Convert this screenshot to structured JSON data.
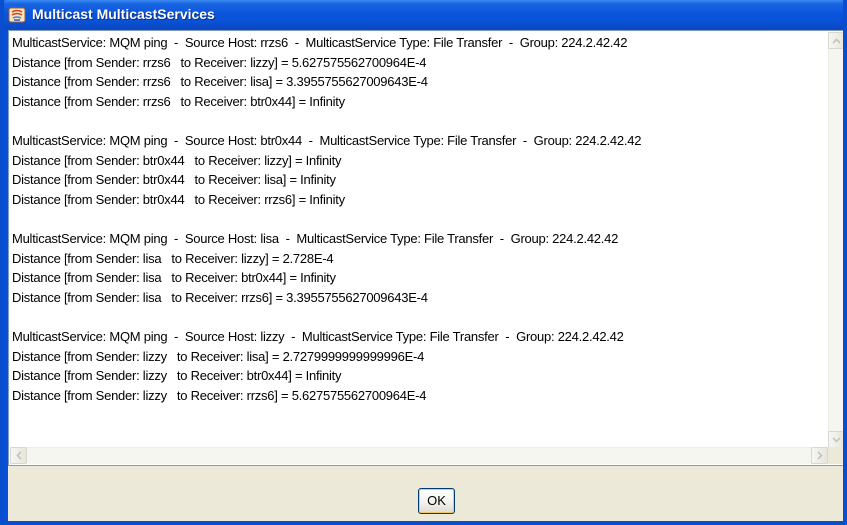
{
  "window": {
    "title": "Multicast MulticastServices",
    "close_label": "✕"
  },
  "output_lines": [
    "MulticastService: MQM ping  -  Source Host: rrzs6  -  MulticastService Type: File Transfer  -  Group: 224.2.42.42",
    "Distance [from Sender: rrzs6   to Receiver: lizzy] = 5.627575562700964E-4",
    "Distance [from Sender: rrzs6   to Receiver: lisa] = 3.3955755627009643E-4",
    "Distance [from Sender: rrzs6   to Receiver: btr0x44] = Infinity",
    "",
    "MulticastService: MQM ping  -  Source Host: btr0x44  -  MulticastService Type: File Transfer  -  Group: 224.2.42.42",
    "Distance [from Sender: btr0x44   to Receiver: lizzy] = Infinity",
    "Distance [from Sender: btr0x44   to Receiver: lisa] = Infinity",
    "Distance [from Sender: btr0x44   to Receiver: rrzs6] = Infinity",
    "",
    "MulticastService: MQM ping  -  Source Host: lisa  -  MulticastService Type: File Transfer  -  Group: 224.2.42.42",
    "Distance [from Sender: lisa   to Receiver: lizzy] = 2.728E-4",
    "Distance [from Sender: lisa   to Receiver: btr0x44] = Infinity",
    "Distance [from Sender: lisa   to Receiver: rrzs6] = 3.3955755627009643E-4",
    "",
    "MulticastService: MQM ping  -  Source Host: lizzy  -  MulticastService Type: File Transfer  -  Group: 224.2.42.42",
    "Distance [from Sender: lizzy   to Receiver: lisa] = 2.7279999999999996E-4",
    "Distance [from Sender: lizzy   to Receiver: btr0x44] = Infinity",
    "Distance [from Sender: lizzy   to Receiver: rrzs6] = 5.627575562700964E-4"
  ],
  "buttons": {
    "ok_label": "OK"
  },
  "icons": {
    "app": "java-app-icon",
    "scroll_up": "chevron-up-icon",
    "scroll_down": "chevron-down-icon",
    "scroll_left": "chevron-left-icon",
    "scroll_right": "chevron-right-icon"
  },
  "colors": {
    "titlebar": "#0a55dc",
    "close_button": "#e05a2e",
    "dialog_background": "#ece9d8",
    "text_background": "#ffffff"
  }
}
